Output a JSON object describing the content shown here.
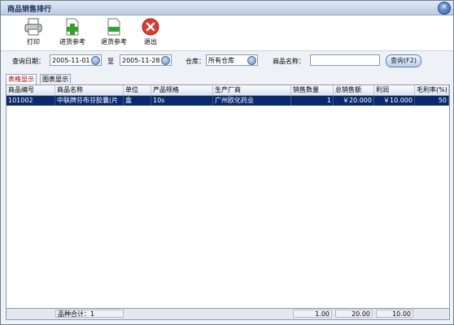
{
  "window": {
    "title": "商品销售排行",
    "close_icon": "close-icon"
  },
  "toolbar": {
    "print_label": "打印",
    "purchase_ref_label": "进货参考",
    "return_ref_label": "退货参考",
    "exit_label": "退出"
  },
  "filters": {
    "date_label": "查询日期：",
    "date_from": "2005-11-01",
    "to_label": "至",
    "date_to": "2005-11-28",
    "warehouse_label": "仓库：",
    "warehouse_value": "所有仓库",
    "product_name_label": "商品名称：",
    "product_name_value": "",
    "query_label": "查询(F2)"
  },
  "tabs": [
    {
      "label": "表格显示",
      "active": true
    },
    {
      "label": "图表显示",
      "active": false
    }
  ],
  "table": {
    "columns": [
      "商品编号",
      "商品名称",
      "单位",
      "产品规格",
      "生产厂商",
      "销售数量",
      "总销售额",
      "利润",
      "毛利率(%)"
    ],
    "rows": [
      [
        "101002",
        "中联牌芬布芬胶囊(片",
        "盒",
        "10s",
        "广州欧化药业",
        "1",
        "￥20.000",
        "￥10.000",
        "50"
      ]
    ]
  },
  "footer": {
    "count_text": "品种合计：1",
    "qty_total": "1.00",
    "sales_total": "20.00",
    "profit_total": "10.00"
  },
  "colors": {
    "selected_row": "#0a2a6e",
    "active_tab_text": "#b00000"
  }
}
